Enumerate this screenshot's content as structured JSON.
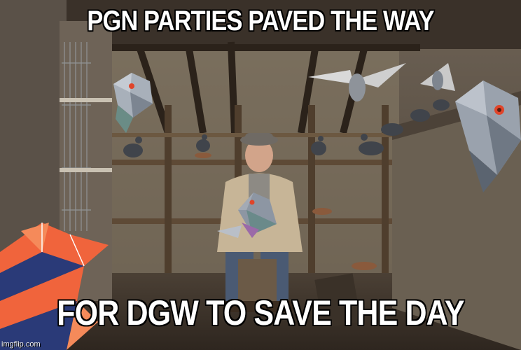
{
  "meme": {
    "top_text": "PGN PARTIES PAVED THE WAY",
    "bottom_text": "FOR DGW TO SAVE THE DAY",
    "watermark": "imgflip.com"
  },
  "colors": {
    "wall": "#7a6e60",
    "wall_dark": "#3e362e",
    "floor": "#4a3f33",
    "beam": "#3b2f24",
    "shelf": "#5e4a36",
    "logo_orange": "#f0643c",
    "logo_navy": "#2a3a78",
    "pigeon_grey": "#8d96a3",
    "pigeon_eye": "#e0452a"
  }
}
